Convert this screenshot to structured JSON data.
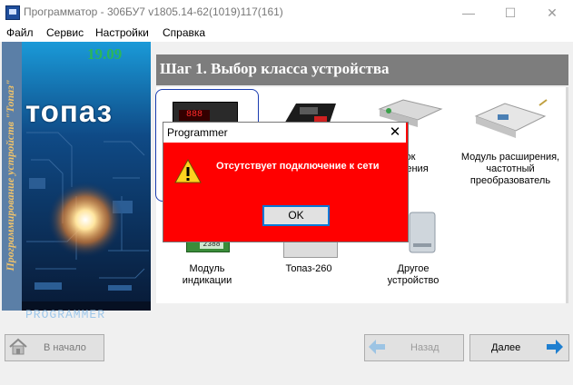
{
  "window": {
    "title": "Программатор - 306БУ7 v1805.14-62(1019)117(161)",
    "minimize": "—",
    "maximize": "☐",
    "close": "✕"
  },
  "menu": [
    {
      "label": "Файл"
    },
    {
      "label": "Сервис"
    },
    {
      "label": "Настройки"
    },
    {
      "label": "Справка"
    }
  ],
  "sidebar": {
    "vertical_text": "Программирование  устройств  \"Топаз\"",
    "version": "19.09",
    "logo": "топаз",
    "caption": "PROGRAMMER"
  },
  "step": {
    "title": "Шаг 1. Выбор класса устройства"
  },
  "devices": [
    {
      "label": ""
    },
    {
      "label": ""
    },
    {
      "label": "лок\nжения"
    },
    {
      "label": "Модуль расширения,\nчастотный\nпреобразователь"
    },
    {
      "label": "Модуль\nиндикации"
    },
    {
      "label": "Топаз-260"
    },
    {
      "label": "Другое\nустройство"
    }
  ],
  "buttons": {
    "home": "В начало",
    "back": "Назад",
    "next": "Далее"
  },
  "dialog": {
    "title": "Programmer",
    "close": "✕",
    "message": "Отсутствует подключение к сети",
    "ok": "OK",
    "background": "#ff0000"
  },
  "colors": {
    "accent": "#0078d7",
    "header": "#7d7d7d"
  }
}
